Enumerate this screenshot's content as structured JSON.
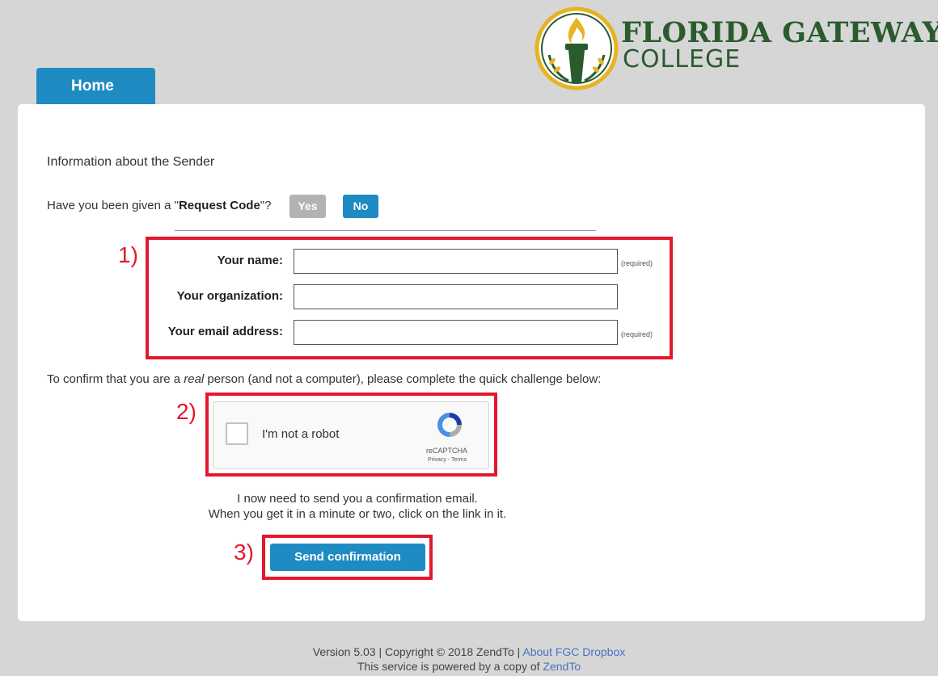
{
  "header": {
    "tab_home": "Home",
    "logo_line1": "FLORIDA GATEWAY",
    "logo_line2": "COLLEGE"
  },
  "sender": {
    "section_title": "Information about the Sender",
    "request_code_prefix": "Have you been given a \"",
    "request_code_bold": "Request Code",
    "request_code_suffix": "\"?",
    "yes_label": "Yes",
    "no_label": "No"
  },
  "annotations": {
    "mark1": "1)",
    "mark2": "2)",
    "mark3": "3)",
    "color": "#e3182d"
  },
  "form": {
    "name_label": "Your name:",
    "name_value": "",
    "name_note": "(required)",
    "org_label": "Your organization:",
    "org_value": "",
    "email_label": "Your email address:",
    "email_value": "",
    "email_note": "(required)"
  },
  "captcha": {
    "intro_before": "To confirm that you are a ",
    "intro_italic": "real",
    "intro_after": " person (and not a computer), please complete the quick challenge below:",
    "checkbox_label": "I'm not a robot",
    "brand": "reCAPTCHA",
    "links": "Privacy - Terms",
    "checked": false
  },
  "confirmation": {
    "line1": "I now need to send you a confirmation email.",
    "line2": "When you get it in a minute or two, click on the link in it.",
    "button": "Send confirmation"
  },
  "footer": {
    "version": "Version 5.03 | Copyright © 2018 ZendTo | ",
    "about_link": "About FGC Dropbox",
    "powered_prefix": "This service is powered by a copy of ",
    "powered_link": "ZendTo"
  },
  "colors": {
    "accent": "#1e8bc3",
    "disabled": "#b3b3b3",
    "brand_green": "#2a5b2e",
    "brand_gold": "#e6b422"
  }
}
